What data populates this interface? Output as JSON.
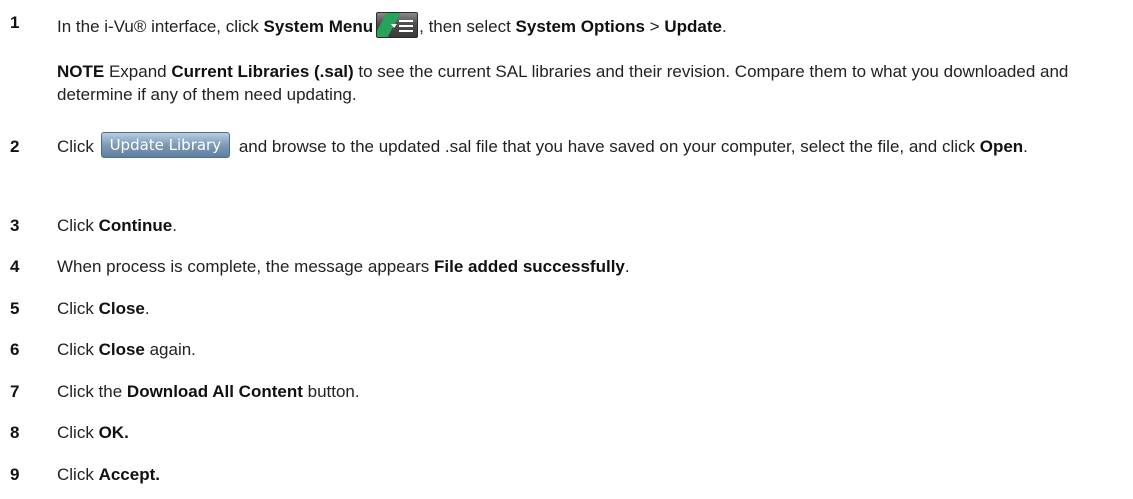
{
  "steps": [
    {
      "num": "1",
      "t1": "In the i-Vu® interface, click ",
      "b1": "System Menu",
      "icon": "system-menu-icon",
      "t2": ", then select ",
      "b2": "System Options",
      "t3": " > ",
      "b3": "Update",
      "t4": "."
    },
    {
      "num": "2",
      "t1": "Click ",
      "button_label": "Update Library",
      "t2": " and browse to the updated .sal file that you have saved on your computer, select the file, and click ",
      "b1": "Open",
      "t3": "."
    },
    {
      "num": "3",
      "t1": "Click ",
      "b1": "Continue",
      "t2": "."
    },
    {
      "num": "4",
      "t1": "When process is complete, the message appears ",
      "b1": "File added successfully",
      "t2": "."
    },
    {
      "num": "5",
      "t1": "Click ",
      "b1": "Close",
      "t2": "."
    },
    {
      "num": "6",
      "t1": "Click ",
      "b1": "Close",
      "t2": " again."
    },
    {
      "num": "7",
      "t1": "Click the ",
      "b1": "Download All Content",
      "t2": " button."
    },
    {
      "num": "8",
      "t1": "Click ",
      "b1": "OK."
    },
    {
      "num": "9",
      "t1": "Click ",
      "b1": "Accept."
    }
  ],
  "note": {
    "label": "NOTE",
    "t1": " Expand ",
    "b1": "Current Libraries (.sal)",
    "t2": " to see the current SAL libraries and their revision. Compare them to what you downloaded and determine if any of them need updating."
  }
}
